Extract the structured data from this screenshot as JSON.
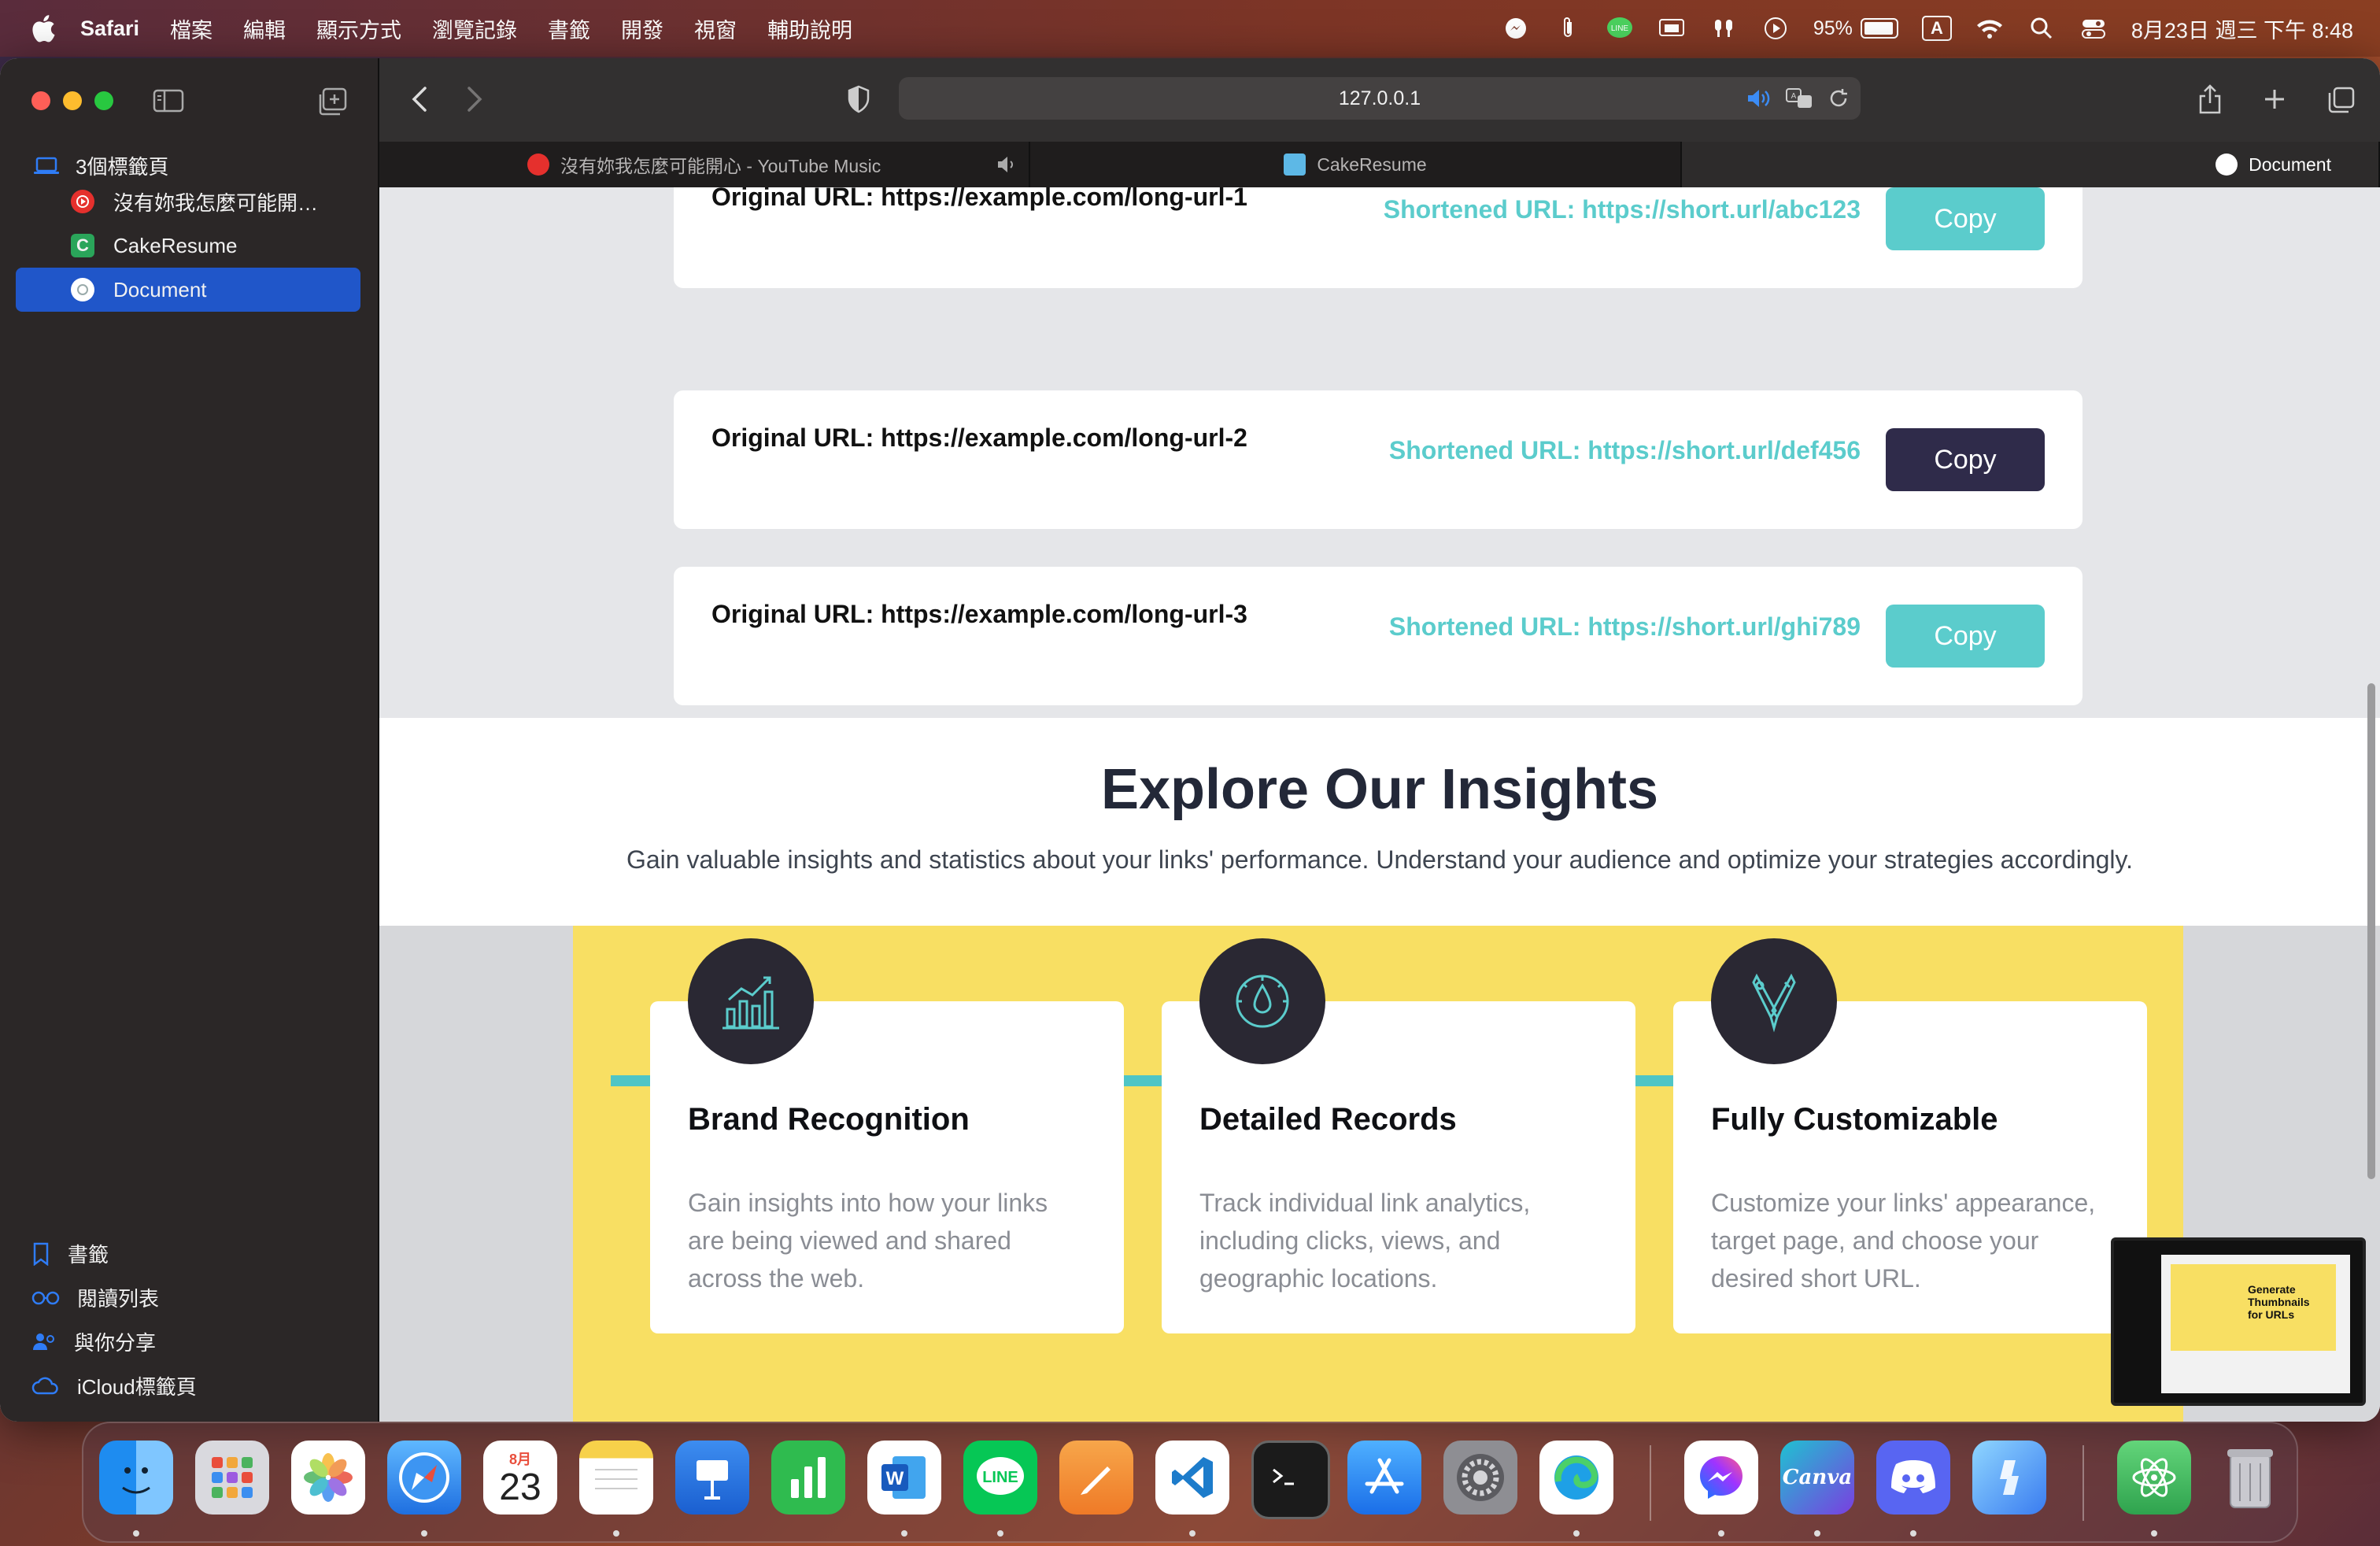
{
  "menubar": {
    "app_name": "Safari",
    "items": [
      "檔案",
      "編輯",
      "顯示方式",
      "瀏覽記錄",
      "書籤",
      "開發",
      "視窗",
      "輔助說明"
    ],
    "battery": "95%",
    "input_source": "A",
    "clock": "8月23日 週三 下午 8:48"
  },
  "sidebar": {
    "tab_group": "3個標籤頁",
    "tabs": [
      {
        "label": "沒有妳我怎麼可能開…",
        "icon": "youtube-music-icon"
      },
      {
        "label": "CakeResume",
        "icon": "cakeresume-icon"
      },
      {
        "label": "Document",
        "icon": "document-icon"
      }
    ],
    "bottom": [
      {
        "label": "書籤",
        "icon": "bookmark-icon"
      },
      {
        "label": "閱讀列表",
        "icon": "reading-list-icon"
      },
      {
        "label": "與你分享",
        "icon": "shared-with-you-icon"
      },
      {
        "label": "iCloud標籤頁",
        "icon": "icloud-icon"
      }
    ]
  },
  "toolbar": {
    "address": "127.0.0.1"
  },
  "tabbar": {
    "tabs": [
      {
        "label": "沒有妳我怎麼可能開心 - YouTube Music"
      },
      {
        "label": "CakeResume"
      },
      {
        "label": "Document"
      }
    ]
  },
  "page": {
    "links": [
      {
        "original": "Original URL: https://example.com/long-url-1",
        "short": "Shortened URL: https://short.url/abc123",
        "button": "Copy"
      },
      {
        "original": "Original URL: https://example.com/long-url-2",
        "short": "Shortened URL: https://short.url/def456",
        "button": "Copy"
      },
      {
        "original": "Original URL: https://example.com/long-url-3",
        "short": "Shortened URL: https://short.url/ghi789",
        "button": "Copy"
      }
    ],
    "insights": {
      "title": "Explore Our Insights",
      "subtitle": "Gain valuable insights and statistics about your links' performance. Understand your audience and optimize your strategies accordingly."
    },
    "features": [
      {
        "title": "Brand Recognition",
        "text": "Gain insights into how your links are being viewed and shared across the web.",
        "icon": "bar-chart-icon"
      },
      {
        "title": "Detailed Records",
        "text": "Track individual link analytics, including clicks, views, and geographic locations.",
        "icon": "gauge-icon"
      },
      {
        "title": "Fully Customizable",
        "text": "Customize your links' appearance, target page, and choose your desired short URL.",
        "icon": "brush-pen-icon"
      }
    ],
    "colors": {
      "accent": "#5bcccc",
      "dark_button": "#2f2b4a",
      "yellow": "#f8df63"
    }
  },
  "thumbnail": {
    "title": "Generate Thumbnails for URLs"
  },
  "dock": {
    "calendar_month": "8月",
    "calendar_day": "23",
    "apps": [
      "finder",
      "launchpad",
      "photos",
      "safari",
      "calendar",
      "notes",
      "keynote",
      "numbers",
      "word",
      "line",
      "pages",
      "vscode",
      "terminal",
      "app-store",
      "system-settings",
      "edge",
      "messenger",
      "canva",
      "discord",
      "copilot",
      "atom",
      "trash"
    ]
  }
}
